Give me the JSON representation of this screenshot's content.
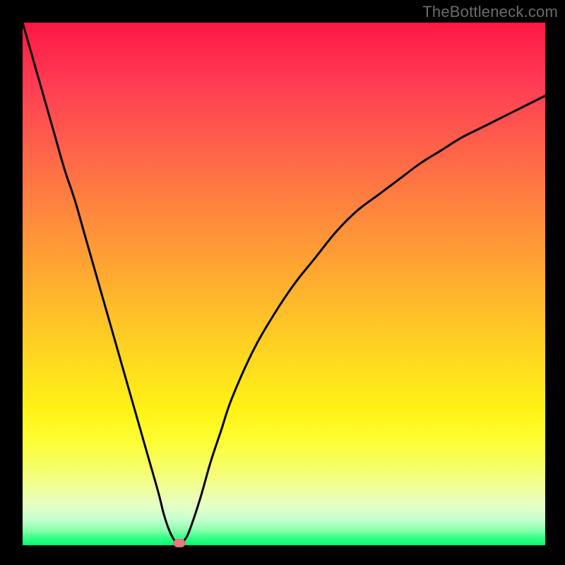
{
  "watermark": "TheBottleneck.com",
  "colors": {
    "gradient_top": "#ff1744",
    "gradient_bottom": "#00ff6e",
    "curve": "#000000",
    "marker": "#e77a7a",
    "background": "#000000"
  },
  "chart_data": {
    "type": "line",
    "title": "",
    "xlabel": "",
    "ylabel": "",
    "xlim": [
      0,
      100
    ],
    "ylim": [
      0,
      100
    ],
    "grid": false,
    "series": [
      {
        "name": "curve",
        "x": [
          0,
          2,
          4,
          6,
          8,
          10,
          12,
          14,
          16,
          18,
          20,
          22,
          24,
          26,
          27,
          28,
          29,
          30,
          31,
          32,
          34,
          36,
          38,
          40,
          44,
          48,
          52,
          56,
          60,
          64,
          68,
          72,
          76,
          80,
          84,
          88,
          92,
          96,
          100
        ],
        "y": [
          100,
          93,
          86,
          79,
          72,
          66,
          59,
          52,
          45,
          38,
          31,
          24,
          17,
          10,
          6,
          3,
          1,
          0,
          1,
          3,
          9,
          16,
          22,
          28,
          37,
          44,
          50,
          55,
          60,
          64,
          67,
          70,
          73,
          75.5,
          78,
          80,
          82,
          84,
          86
        ]
      }
    ],
    "marker": {
      "x": 30,
      "y": 0,
      "note": "minimum"
    }
  }
}
